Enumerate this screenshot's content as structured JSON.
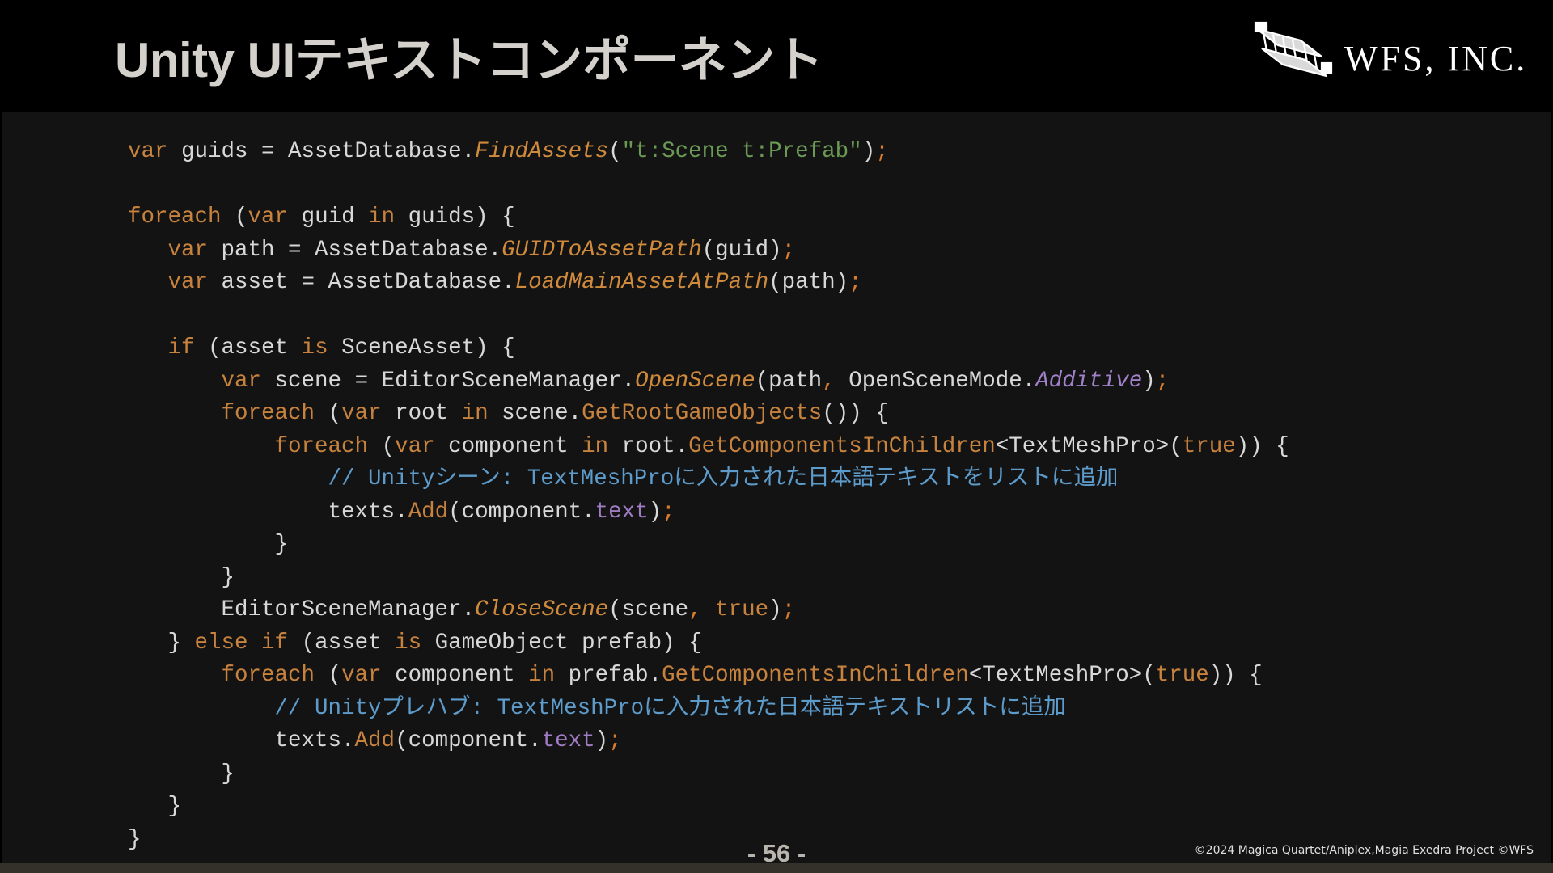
{
  "slide": {
    "title": "Unity UIテキストコンポーネント",
    "logo": {
      "text": "WFS, INC.",
      "icon": "wright-flyer-biplane-icon"
    },
    "page_number": "- 56 -",
    "copyright": "©2024 Magica Quartet/Aniplex,Magia Exedra Project ©WFS"
  },
  "colors": {
    "keyword": "#c7823e",
    "string": "#6a9a53",
    "method": "#cf8a3c",
    "enum_member": "#a080c8",
    "field": "#a07cc4",
    "comment": "#5d9bcb",
    "plain": "#d8d8d8",
    "code_background": "#131313"
  },
  "code": {
    "language": "C#",
    "lines": [
      [
        [
          "kw",
          "var"
        ],
        [
          "p",
          " guids = AssetDatabase."
        ],
        [
          "m",
          "FindAssets"
        ],
        [
          "p",
          "("
        ],
        [
          "s",
          "\"t:Scene t:Prefab\""
        ],
        [
          "p",
          ")"
        ],
        [
          "semi",
          ";"
        ]
      ],
      [],
      [
        [
          "kw",
          "foreach"
        ],
        [
          "p",
          " ("
        ],
        [
          "kw",
          "var"
        ],
        [
          "p",
          " guid "
        ],
        [
          "kw",
          "in"
        ],
        [
          "p",
          " guids) {"
        ]
      ],
      [
        [
          "p",
          "   "
        ],
        [
          "kw",
          "var"
        ],
        [
          "p",
          " path = AssetDatabase."
        ],
        [
          "m",
          "GUIDToAssetPath"
        ],
        [
          "p",
          "(guid)"
        ],
        [
          "semi",
          ";"
        ]
      ],
      [
        [
          "p",
          "   "
        ],
        [
          "kw",
          "var"
        ],
        [
          "p",
          " asset = AssetDatabase."
        ],
        [
          "m",
          "LoadMainAssetAtPath"
        ],
        [
          "p",
          "(path)"
        ],
        [
          "semi",
          ";"
        ]
      ],
      [],
      [
        [
          "p",
          "   "
        ],
        [
          "kw",
          "if"
        ],
        [
          "p",
          " (asset "
        ],
        [
          "kw",
          "is"
        ],
        [
          "p",
          " SceneAsset) {"
        ]
      ],
      [
        [
          "p",
          "       "
        ],
        [
          "kw",
          "var"
        ],
        [
          "p",
          " scene = EditorSceneManager."
        ],
        [
          "m",
          "OpenScene"
        ],
        [
          "p",
          "(path"
        ],
        [
          "semi",
          ","
        ],
        [
          "p",
          " OpenSceneMode."
        ],
        [
          "e",
          "Additive"
        ],
        [
          "p",
          ")"
        ],
        [
          "semi",
          ";"
        ]
      ],
      [
        [
          "p",
          "       "
        ],
        [
          "kw",
          "foreach"
        ],
        [
          "p",
          " ("
        ],
        [
          "kw",
          "var"
        ],
        [
          "p",
          " root "
        ],
        [
          "kw",
          "in"
        ],
        [
          "p",
          " scene."
        ],
        [
          "kw",
          "GetRootGameObjects"
        ],
        [
          "p",
          "()) {"
        ]
      ],
      [
        [
          "p",
          "           "
        ],
        [
          "kw",
          "foreach"
        ],
        [
          "p",
          " ("
        ],
        [
          "kw",
          "var"
        ],
        [
          "p",
          " component "
        ],
        [
          "kw",
          "in"
        ],
        [
          "p",
          " root."
        ],
        [
          "kw",
          "GetComponentsInChildren"
        ],
        [
          "p",
          "<TextMeshPro>("
        ],
        [
          "kw",
          "true"
        ],
        [
          "p",
          ")) {"
        ]
      ],
      [
        [
          "p",
          "               "
        ],
        [
          "c",
          "// Unityシーン: TextMeshProに入力された日本語テキストをリストに追加"
        ]
      ],
      [
        [
          "p",
          "               texts."
        ],
        [
          "kw",
          "Add"
        ],
        [
          "p",
          "(component."
        ],
        [
          "f",
          "text"
        ],
        [
          "p",
          ")"
        ],
        [
          "semi",
          ";"
        ]
      ],
      [
        [
          "p",
          "           }"
        ]
      ],
      [
        [
          "p",
          "       }"
        ]
      ],
      [
        [
          "p",
          "       EditorSceneManager."
        ],
        [
          "m",
          "CloseScene"
        ],
        [
          "p",
          "(scene"
        ],
        [
          "semi",
          ","
        ],
        [
          "p",
          " "
        ],
        [
          "kw",
          "true"
        ],
        [
          "p",
          ")"
        ],
        [
          "semi",
          ";"
        ]
      ],
      [
        [
          "p",
          "   } "
        ],
        [
          "kw",
          "else"
        ],
        [
          "p",
          " "
        ],
        [
          "kw",
          "if"
        ],
        [
          "p",
          " (asset "
        ],
        [
          "kw",
          "is"
        ],
        [
          "p",
          " GameObject prefab) {"
        ]
      ],
      [
        [
          "p",
          "       "
        ],
        [
          "kw",
          "foreach"
        ],
        [
          "p",
          " ("
        ],
        [
          "kw",
          "var"
        ],
        [
          "p",
          " component "
        ],
        [
          "kw",
          "in"
        ],
        [
          "p",
          " prefab."
        ],
        [
          "kw",
          "GetComponentsInChildren"
        ],
        [
          "p",
          "<TextMeshPro>("
        ],
        [
          "kw",
          "true"
        ],
        [
          "p",
          ")) {"
        ]
      ],
      [
        [
          "p",
          "           "
        ],
        [
          "c",
          "// Unityプレハブ: TextMeshProに入力された日本語テキストリストに追加"
        ]
      ],
      [
        [
          "p",
          "           texts."
        ],
        [
          "kw",
          "Add"
        ],
        [
          "p",
          "(component."
        ],
        [
          "f",
          "text"
        ],
        [
          "p",
          ")"
        ],
        [
          "semi",
          ";"
        ]
      ],
      [
        [
          "p",
          "       }"
        ]
      ],
      [
        [
          "p",
          "   }"
        ]
      ],
      [
        [
          "p",
          "}"
        ]
      ]
    ]
  }
}
